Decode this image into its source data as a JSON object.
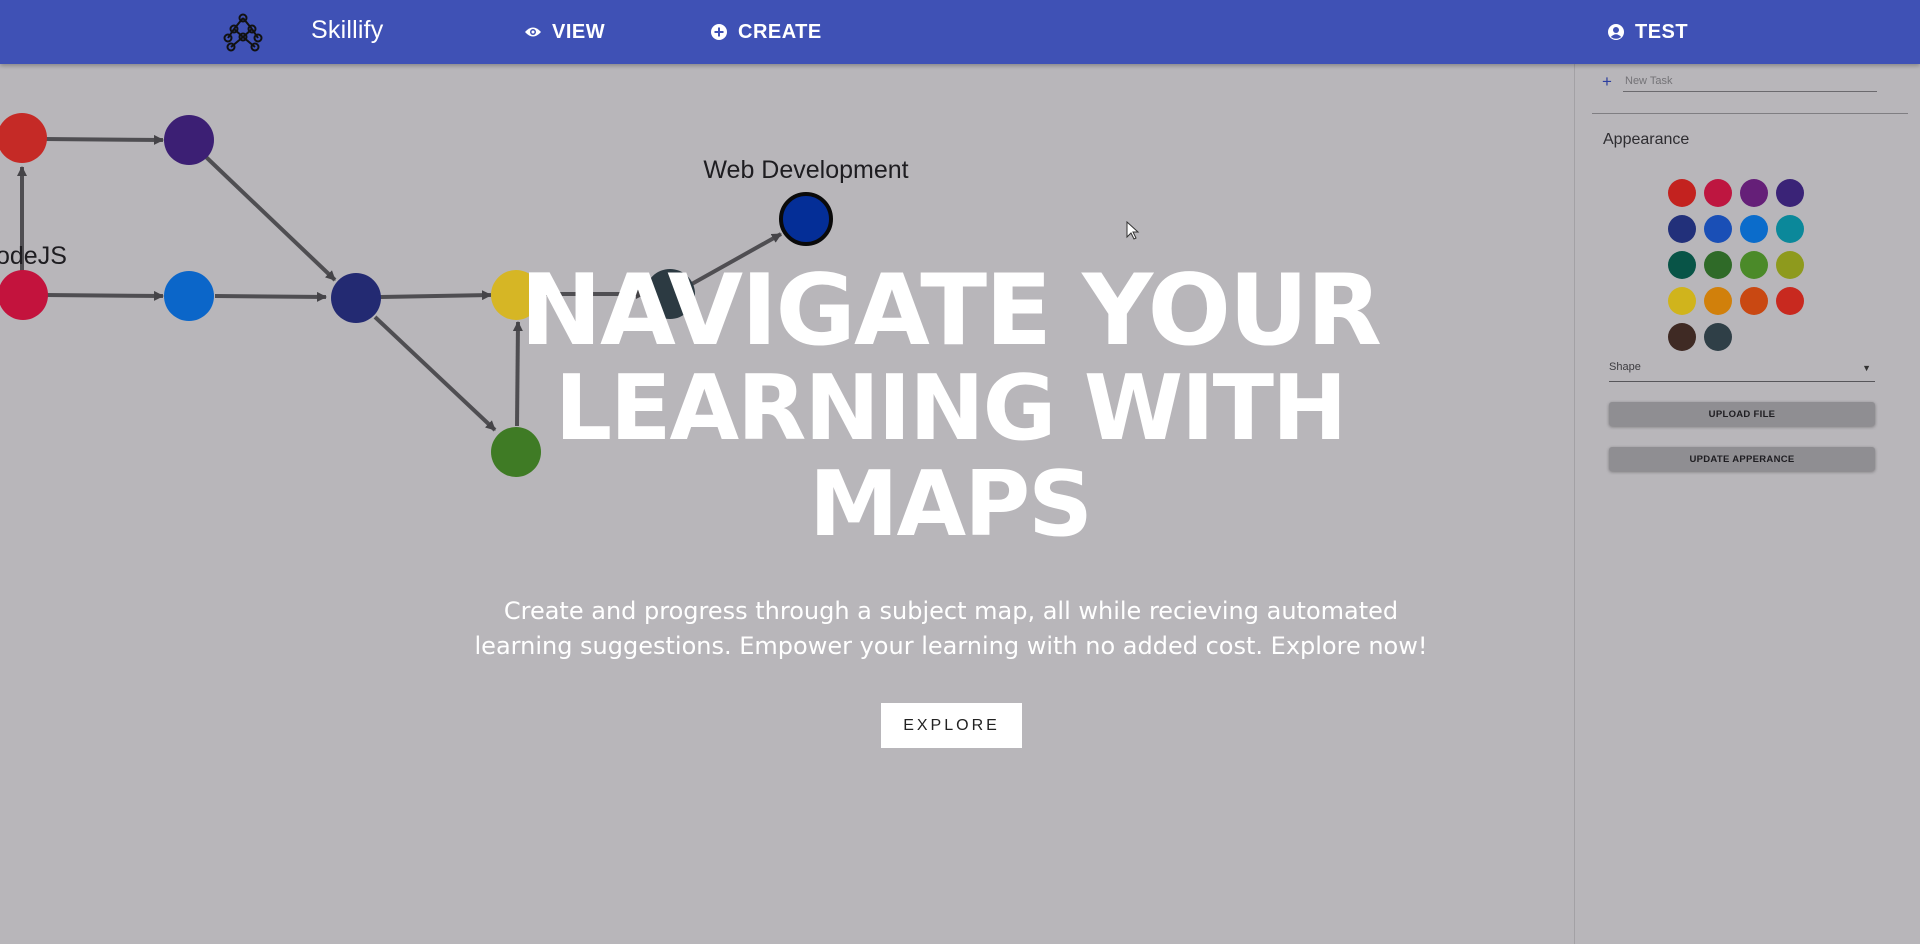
{
  "header": {
    "brand": "Skillify",
    "nav": {
      "view_label": "VIEW",
      "create_label": "CREATE",
      "user_label": "TEST"
    }
  },
  "map": {
    "labels": {
      "node_left": "odeJS",
      "node_top": "Web Development"
    },
    "node_colors": [
      "#c52a26",
      "#3c1f74",
      "#c3133d",
      "#0b66c9",
      "#232a72",
      "#d6b625",
      "#2c3a42",
      "#042e97",
      "#3f7b25"
    ]
  },
  "hero": {
    "title_line1": "NAVIGATE YOUR",
    "title_line2": "LEARNING WITH",
    "title_line3": "MAPS",
    "subtitle_line1": "Create and progress through a subject map, all while recieving automated",
    "subtitle_line2": "learning suggestions. Empower your learning with no added cost. Explore now!",
    "explore_label": "EXPLORE"
  },
  "panel": {
    "new_task_placeholder": "New Task",
    "appearance_title": "Appearance",
    "swatches": [
      "#c3221f",
      "#be1640",
      "#651f78",
      "#3a2377",
      "#22307a",
      "#1a4fb6",
      "#0b6ccb",
      "#0b889a",
      "#085447",
      "#2f6a28",
      "#4b8a29",
      "#8e9a1d",
      "#d0b41c",
      "#d1800b",
      "#c94812",
      "#c8291f",
      "#3f2a24",
      "#2f3f47"
    ],
    "shape_label": "Shape",
    "upload_label": "UPLOAD FILE",
    "update_label": "UPDATE APPERANCE"
  }
}
